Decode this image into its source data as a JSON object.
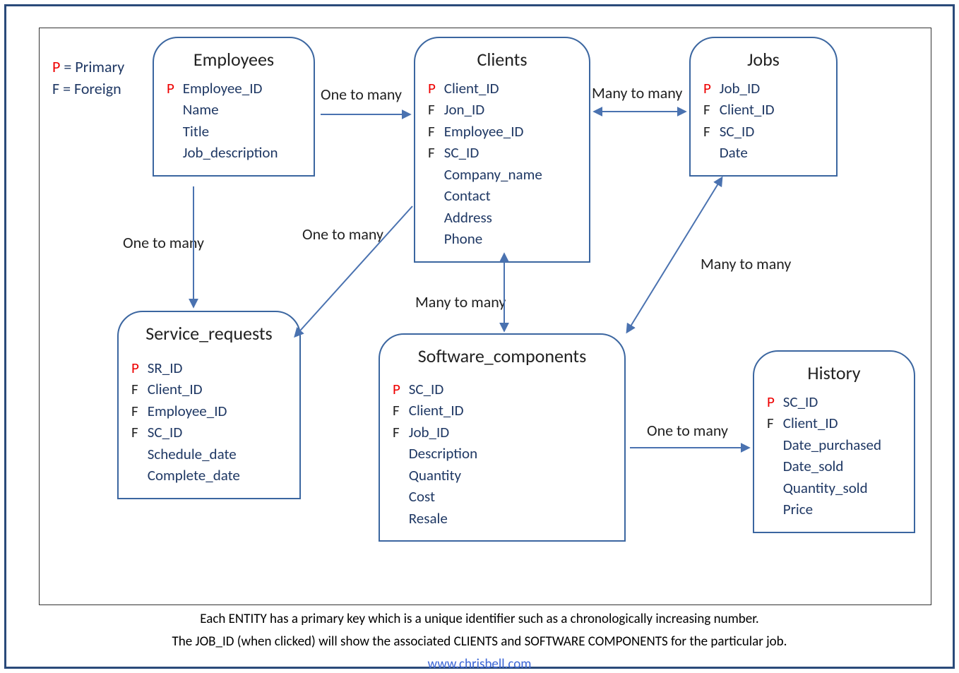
{
  "legend": {
    "p_label": "P",
    "p_text": " = Primary",
    "f_label": "F",
    "f_text": " = Foreign"
  },
  "entities": {
    "employees": {
      "title": "Employees",
      "fields": [
        {
          "key": "P",
          "name": "Employee_ID"
        },
        {
          "key": "",
          "name": "Name"
        },
        {
          "key": "",
          "name": "Title"
        },
        {
          "key": "",
          "name": "Job_description"
        }
      ]
    },
    "clients": {
      "title": "Clients",
      "fields": [
        {
          "key": "P",
          "name": "Client_ID"
        },
        {
          "key": "F",
          "name": "Jon_ID"
        },
        {
          "key": "F",
          "name": "Employee_ID"
        },
        {
          "key": "F",
          "name": "SC_ID"
        },
        {
          "key": "",
          "name": "Company_name"
        },
        {
          "key": "",
          "name": "Contact"
        },
        {
          "key": "",
          "name": "Address"
        },
        {
          "key": "",
          "name": "Phone"
        }
      ]
    },
    "jobs": {
      "title": "Jobs",
      "fields": [
        {
          "key": "P",
          "name": "Job_ID"
        },
        {
          "key": "F",
          "name": "Client_ID"
        },
        {
          "key": "F",
          "name": "SC_ID"
        },
        {
          "key": "",
          "name": "Date"
        }
      ]
    },
    "service_requests": {
      "title": "Service_requests",
      "fields": [
        {
          "key": "P",
          "name": "SR_ID"
        },
        {
          "key": "F",
          "name": "Client_ID"
        },
        {
          "key": "F",
          "name": "Employee_ID"
        },
        {
          "key": "F",
          "name": "SC_ID"
        },
        {
          "key": "",
          "name": "Schedule_date"
        },
        {
          "key": "",
          "name": "Complete_date"
        }
      ]
    },
    "software_components": {
      "title": "Software_components",
      "fields": [
        {
          "key": "P",
          "name": "SC_ID"
        },
        {
          "key": "F",
          "name": "Client_ID"
        },
        {
          "key": "F",
          "name": "Job_ID"
        },
        {
          "key": "",
          "name": "Description"
        },
        {
          "key": "",
          "name": "Quantity"
        },
        {
          "key": "",
          "name": "Cost"
        },
        {
          "key": "",
          "name": "Resale"
        }
      ]
    },
    "history": {
      "title": "History",
      "fields": [
        {
          "key": "P",
          "name": "SC_ID"
        },
        {
          "key": "F",
          "name": "Client_ID"
        },
        {
          "key": "",
          "name": "Date_purchased"
        },
        {
          "key": "",
          "name": "Date_sold"
        },
        {
          "key": "",
          "name": "Quantity_sold"
        },
        {
          "key": "",
          "name": "Price"
        }
      ]
    }
  },
  "relations": {
    "emp_clients": "One to many",
    "clients_jobs": "Many to many",
    "emp_sr": "One to many",
    "clients_sr": "One to many",
    "clients_sc": "Many to many",
    "jobs_sc": "Many to many",
    "sc_history": "One to many"
  },
  "footer": {
    "line1": "Each ENTITY has a primary key which is a unique identifier such as a chronologically increasing number.",
    "line2": "The JOB_ID (when clicked) will show the associated CLIENTS and SOFTWARE COMPONENTS for the particular job.",
    "link": "www.chrisbell.com"
  }
}
